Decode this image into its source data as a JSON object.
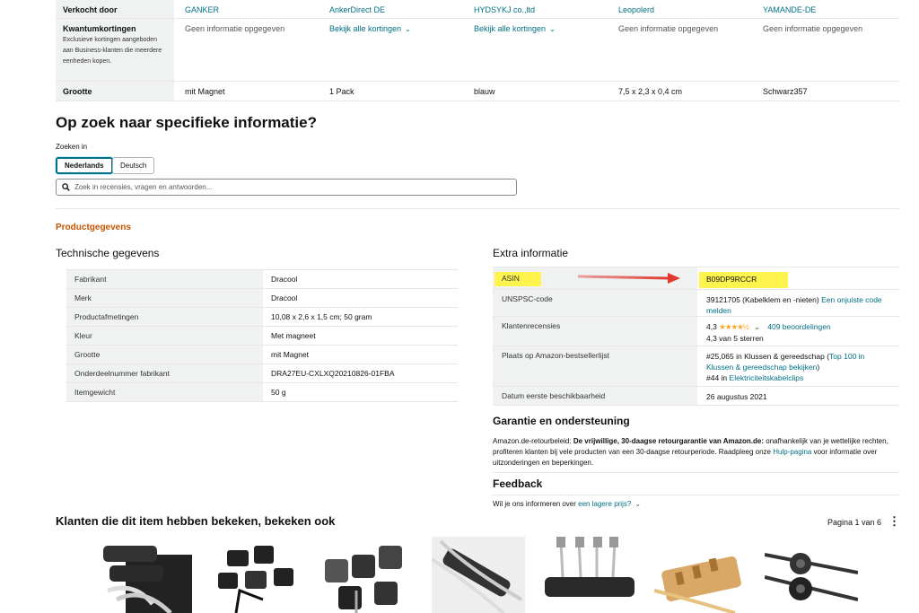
{
  "comparison": {
    "rows": [
      {
        "head": "Verkocht door",
        "sub": "",
        "cells": [
          {
            "text": "GANKER",
            "link": true
          },
          {
            "text": "AnkerDirect DE",
            "link": true
          },
          {
            "text": "HYDSYKJ co.,ltd",
            "link": true
          },
          {
            "text": "Leopolerd",
            "link": true
          },
          {
            "text": "YAMANDE-DE",
            "link": true
          }
        ]
      },
      {
        "head": "Kwantumkortingen",
        "sub": "Exclusieve kortingen aangeboden aan Business-klanten die meerdere eenheden kopen.",
        "cells": [
          {
            "text": "Geen informatie opgegeven",
            "link": false
          },
          {
            "text": "Bekijk alle kortingen",
            "link": true,
            "chevron": true
          },
          {
            "text": "Bekijk alle kortingen",
            "link": true,
            "chevron": true
          },
          {
            "text": "Geen informatie opgegeven",
            "link": false
          },
          {
            "text": "Geen informatie opgegeven",
            "link": false
          }
        ]
      },
      {
        "head": "Grootte",
        "sub": "",
        "cells": [
          {
            "text": "mit Magnet",
            "link": false
          },
          {
            "text": "1 Pack",
            "link": false
          },
          {
            "text": "blauw",
            "link": false
          },
          {
            "text": "7,5 x 2,3 x 0,4 cm",
            "link": false
          },
          {
            "text": "Schwarz357",
            "link": false
          }
        ]
      }
    ]
  },
  "search_section": {
    "title": "Op zoek naar specifieke informatie?",
    "search_in_label": "Zoeken in",
    "lang_nl": "Nederlands",
    "lang_de": "Deutsch",
    "placeholder": "Zoek in recensies, vragen en antwoorden..."
  },
  "product_details": {
    "heading": "Productgegevens",
    "tech_title": "Technische gegevens",
    "tech_rows": [
      {
        "k": "Fabrikant",
        "v": "Dracool"
      },
      {
        "k": "Merk",
        "v": "Dracool"
      },
      {
        "k": "Productafmetingen",
        "v": "10,08 x 2,6 x 1,5 cm; 50 gram"
      },
      {
        "k": "Kleur",
        "v": "Met magneet"
      },
      {
        "k": "Grootte",
        "v": "mit Magnet"
      },
      {
        "k": "Onderdeelnummer fabrikant",
        "v": "DRA27EU-CXLXQ20210826-01FBA"
      },
      {
        "k": "Itemgewicht",
        "v": "50 g"
      }
    ],
    "extra_title": "Extra informatie",
    "extra": {
      "asin_label": "ASIN",
      "asin_value": "B09DP9RCCR",
      "unspsc_label": "UNSPSC-code",
      "unspsc_value": "39121705 (Kabelklem en -nieten)",
      "unspsc_link": "Een onjuiste code melden",
      "reviews_label": "Klantenrecensies",
      "rating": "4,3",
      "stars": "★★★★½",
      "review_count": "409 beoordelingen",
      "rating_text": "4,3 van 5 sterren",
      "bsr_label": "Plaats op Amazon-bestsellerlijst",
      "bsr_1": "#25,065 in Klussen & gereedschap (",
      "bsr_1_link": "Top 100 in Klussen & gereedschap bekijken",
      "bsr_1_end": ")",
      "bsr_2": "#44 in ",
      "bsr_2_link": "Elektriciteitskabelclips",
      "date_label": "Datum eerste beschikbaarheid",
      "date_value": "26 augustus 2021"
    }
  },
  "warranty": {
    "title": "Garantie en ondersteuning",
    "lead": "Amazon.de-retourbeleid: ",
    "bold": "De vrijwillige, 30-daagse retourgarantie van Amazon.de:",
    "text": " onafhankelijk van je wettelijke rechten, profiteren klanten bij vele producten van een 30-daagse retourperiode. Raadpleeg onze ",
    "link": "Hulp-pagina",
    "text2": " voor informatie over uitzonderingen en beperkingen."
  },
  "feedback": {
    "title": "Feedback",
    "question": "Wil je ons informeren over ",
    "link": "een lagere prijs?"
  },
  "also_viewed": {
    "title": "Klanten die dit item hebben bekeken, bekeken ook",
    "pager": "Pagina 1 van 6"
  },
  "colors": {
    "link": "#007185",
    "heading_orange": "#c45500",
    "highlight": "#fff34d",
    "arrow": "#e23a2e"
  }
}
